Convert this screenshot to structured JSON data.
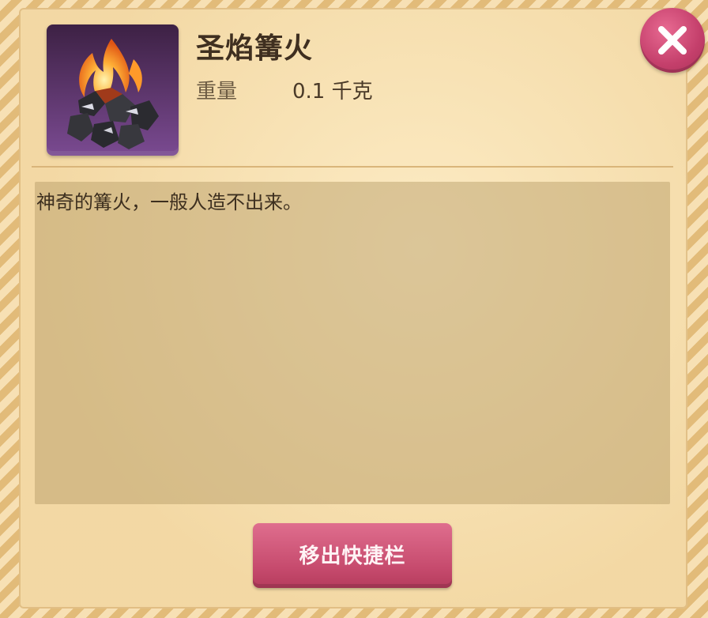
{
  "item": {
    "name": "圣焰篝火",
    "weight_label": "重量",
    "weight_value": "0.1 千克",
    "description": "神奇的篝火，一般人造不出来。",
    "icon": "campfire-icon"
  },
  "actions": {
    "remove_from_hotbar": "移出快捷栏",
    "close_icon": "close-icon"
  },
  "colors": {
    "accent_button": "#c64a6d",
    "close_button": "#c43f6b",
    "panel_bg": "#f6dfae",
    "desc_bg": "#b49a63",
    "title_text": "#3f2f20"
  }
}
